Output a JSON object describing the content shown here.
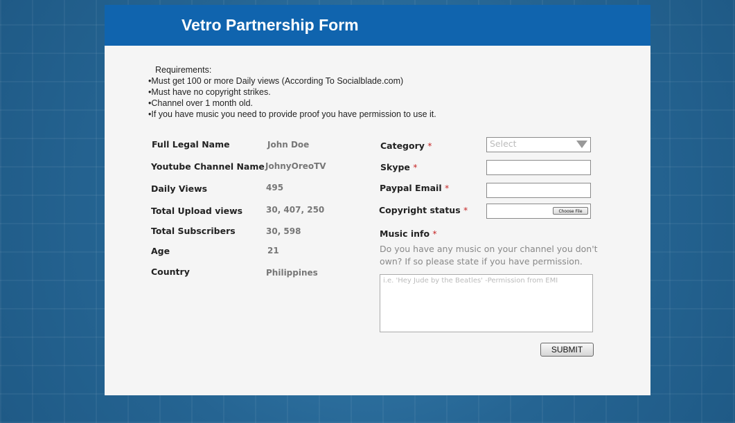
{
  "form_title": "Vetro Partnership Form",
  "requirements": {
    "title": "Requirements:",
    "items": [
      "Must get 100 or more Daily views (According To Socialblade.com)",
      "Must have no copyright strikes.",
      "Channel over 1 month old.",
      "If you have music you need to provide proof you have permission to use it."
    ]
  },
  "profile": [
    {
      "label": "Full Legal Name",
      "value": "John Doe"
    },
    {
      "label": "Youtube Channel Name",
      "value": "JohnyOreoTV"
    },
    {
      "label": "Daily Views",
      "value": "495"
    },
    {
      "label": "Total Upload views",
      "value": "30, 407, 250"
    },
    {
      "label": "Total Subscribers",
      "value": "30, 598"
    },
    {
      "label": "Age",
      "value": "21"
    },
    {
      "label": "Country",
      "value": "Philippines"
    }
  ],
  "right_fields": {
    "category_label": "Category",
    "category_value": "Select",
    "skype_label": "Skype",
    "skype_value": "",
    "paypal_label": "Paypal Email",
    "paypal_value": "",
    "copyright_label": "Copyright status",
    "choose_file_label": "Choose File",
    "required_mark": "*"
  },
  "music": {
    "label": "Music info",
    "description": "Do you have any music on your channel you don't own? If so please state if you have permission.",
    "placeholder": "i.e. 'Hey Jude by the Beatles' -Permission from EMI"
  },
  "submit_label": "SUBMIT",
  "colors": {
    "header": "#1064ae",
    "required": "#c62828"
  }
}
